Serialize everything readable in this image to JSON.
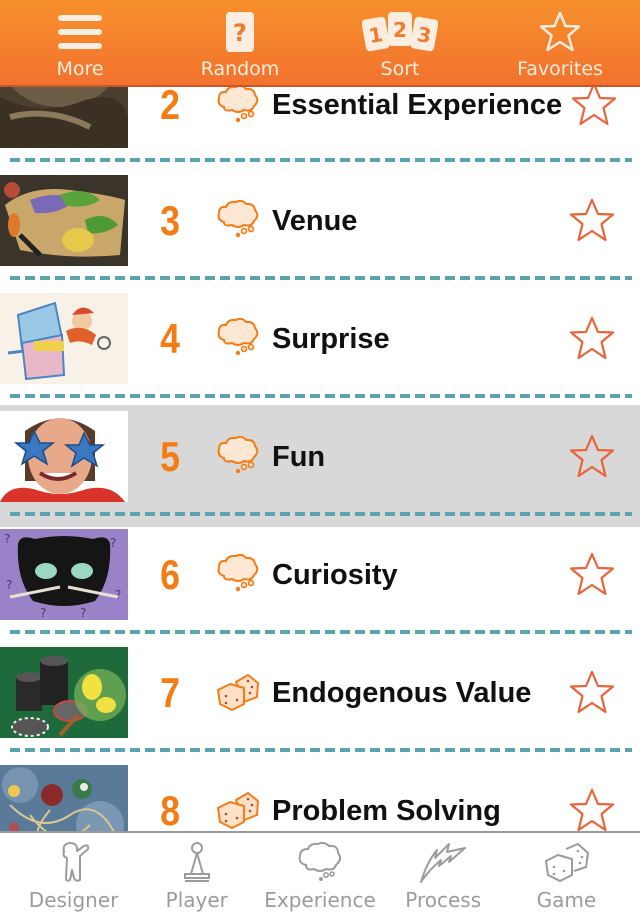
{
  "toolbar": {
    "items": [
      {
        "label": "More",
        "icon": "hamburger-menu-icon"
      },
      {
        "label": "Random",
        "icon": "question-card-icon"
      },
      {
        "label": "Sort",
        "icon": "numbered-cards-icon",
        "card_digits": [
          "1",
          "2",
          "3"
        ]
      },
      {
        "label": "Favorites",
        "icon": "star-icon"
      }
    ],
    "random_glyph": "?"
  },
  "lenses": [
    {
      "number": "2",
      "title": "Essential Experience",
      "category": "experience",
      "image": "eye-orb-image",
      "favorite": false
    },
    {
      "number": "3",
      "title": "Venue",
      "category": "experience",
      "image": "game-map-image",
      "favorite": false
    },
    {
      "number": "4",
      "title": "Surprise",
      "category": "experience",
      "image": "jack-in-the-box-image",
      "favorite": false
    },
    {
      "number": "5",
      "title": "Fun",
      "category": "experience",
      "image": "star-glasses-man-image",
      "favorite": false,
      "selected": true
    },
    {
      "number": "6",
      "title": "Curiosity",
      "category": "experience",
      "image": "cat-mask-image",
      "favorite": false
    },
    {
      "number": "7",
      "title": "Endogenous Value",
      "category": "game",
      "image": "poker-chips-image",
      "favorite": false
    },
    {
      "number": "8",
      "title": "Problem Solving",
      "category": "game",
      "image": "tangled-marbles-image",
      "favorite": false
    }
  ],
  "tabbar": {
    "items": [
      {
        "label": "Designer",
        "icon": "designer-figure-icon"
      },
      {
        "label": "Player",
        "icon": "pawn-icon"
      },
      {
        "label": "Experience",
        "icon": "thought-cloud-icon"
      },
      {
        "label": "Process",
        "icon": "lightning-bolt-icon"
      },
      {
        "label": "Game",
        "icon": "dice-icon"
      }
    ]
  },
  "colors": {
    "header_top": "#f6902c",
    "header_bottom": "#f3722e",
    "number": "#f57c14",
    "star_outline": "#e8643a",
    "divider": "#5aa3b0",
    "selected_row": "#d8d8d8",
    "tab_inactive": "#9b9b9b"
  }
}
